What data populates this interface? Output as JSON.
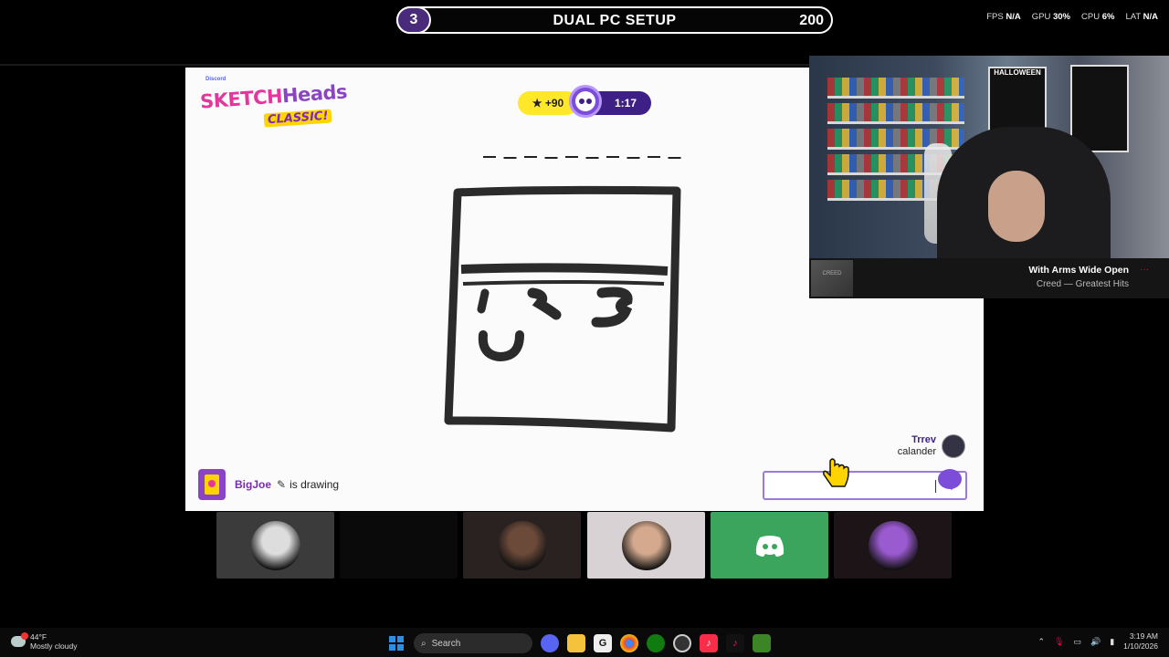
{
  "banner": {
    "round": "3",
    "title": "DUAL PC SETUP",
    "score": "200"
  },
  "stats": {
    "fps_label": "FPS",
    "fps": "N/A",
    "gpu_label": "GPU",
    "gpu": "30%",
    "cpu_label": "CPU",
    "cpu": "6%",
    "lat_label": "LAT",
    "lat": "N/A"
  },
  "game": {
    "logo": {
      "brand": "Discord",
      "sketch": "SKETCH",
      "heads": "Heads",
      "classic": "CLASSIC!"
    },
    "timer": {
      "points": "★ +90",
      "time": "1:17"
    },
    "word_blank_count": 10,
    "drawer": {
      "name": "BigJoe",
      "status": "is drawing"
    },
    "guess": {
      "name": "Trrev",
      "word": "calander"
    },
    "input": {
      "value": ""
    }
  },
  "now_playing": {
    "album_label": "CREED",
    "title": "With Arms Wide Open",
    "artist": "Creed — Greatest Hits",
    "dots": "···"
  },
  "participants": [
    {
      "kind": "avatar",
      "bg": "#3b3b3b",
      "accent": "#ddd"
    },
    {
      "kind": "empty",
      "bg": "#0a0a0a",
      "accent": "#111"
    },
    {
      "kind": "avatar",
      "bg": "#2a2221",
      "accent": "#6b4a3a"
    },
    {
      "kind": "avatar",
      "bg": "#d9d2d4",
      "accent": "#d4a98e"
    },
    {
      "kind": "discord",
      "bg": "#3ba55d",
      "accent": "#ffffff"
    },
    {
      "kind": "avatar",
      "bg": "#1c1416",
      "accent": "#9a5ad0"
    }
  ],
  "taskbar": {
    "weather_temp": "44°F",
    "weather_desc": "Mostly cloudy",
    "search_label": "Search",
    "time": "3:19 AM",
    "date": "1/10/2026"
  }
}
